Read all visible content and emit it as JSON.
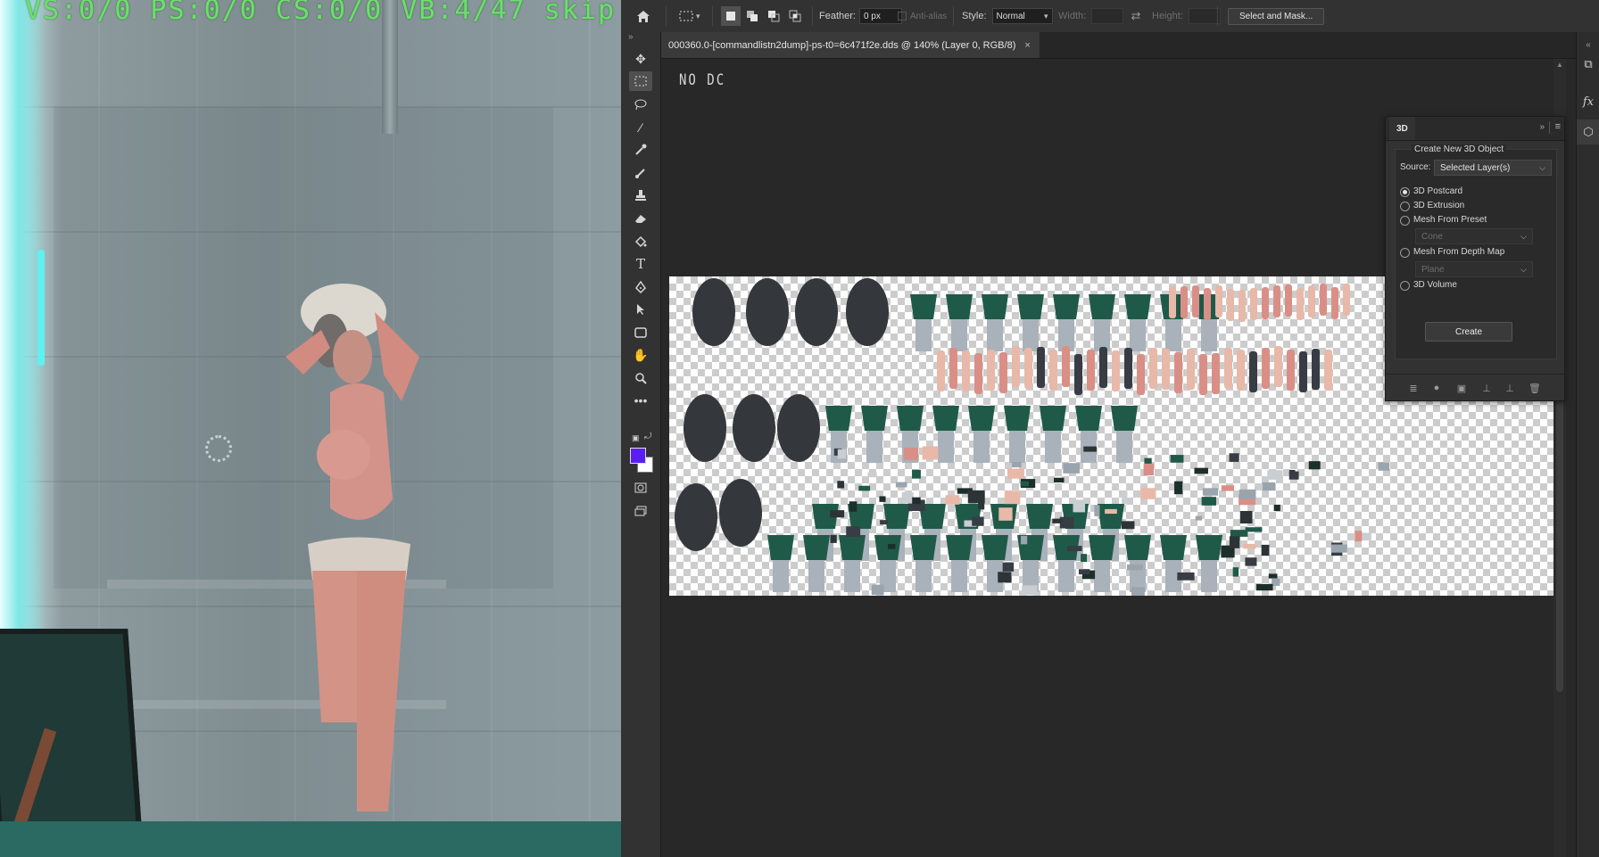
{
  "game": {
    "hud_text": "VS:0/0 PS:0/0 CS:0/0 VB:4/47 skip"
  },
  "options_bar": {
    "feather_label": "Feather:",
    "feather_value": "0 px",
    "antialias_label": "Anti-alias",
    "style_label": "Style:",
    "style_value": "Normal",
    "width_label": "Width:",
    "height_label": "Height:",
    "select_mask_label": "Select and Mask..."
  },
  "document": {
    "tab_title": "000360.0-[commandlistn2dump]-ps-t0=6c471f2e.dds @ 140% (Layer 0, RGB/8)",
    "canvas_text": "NO DC"
  },
  "colors": {
    "foreground": "#5a1ff0",
    "background": "#ffffff",
    "hud": "#6be06b"
  },
  "panel_3d": {
    "tab_label": "3D",
    "section_title": "Create New 3D Object",
    "source_label": "Source:",
    "source_value": "Selected Layer(s)",
    "options": [
      {
        "label": "3D Postcard",
        "selected": true
      },
      {
        "label": "3D Extrusion",
        "selected": false
      },
      {
        "label": "Mesh From Preset",
        "selected": false
      },
      {
        "label": "Mesh From Depth Map",
        "selected": false
      },
      {
        "label": "3D Volume",
        "selected": false
      }
    ],
    "preset_value": "Cone",
    "depth_map_value": "Plane",
    "create_label": "Create"
  },
  "tools": [
    "move-tool",
    "rectangular-marquee-tool",
    "lasso-tool",
    "magic-wand-tool",
    "eyedropper-tool",
    "brush-tool",
    "clone-stamp-tool",
    "eraser-tool",
    "paint-bucket-tool",
    "type-tool",
    "pen-tool",
    "path-selection-tool",
    "rectangle-tool",
    "hand-tool",
    "zoom-tool",
    "more-tools"
  ]
}
